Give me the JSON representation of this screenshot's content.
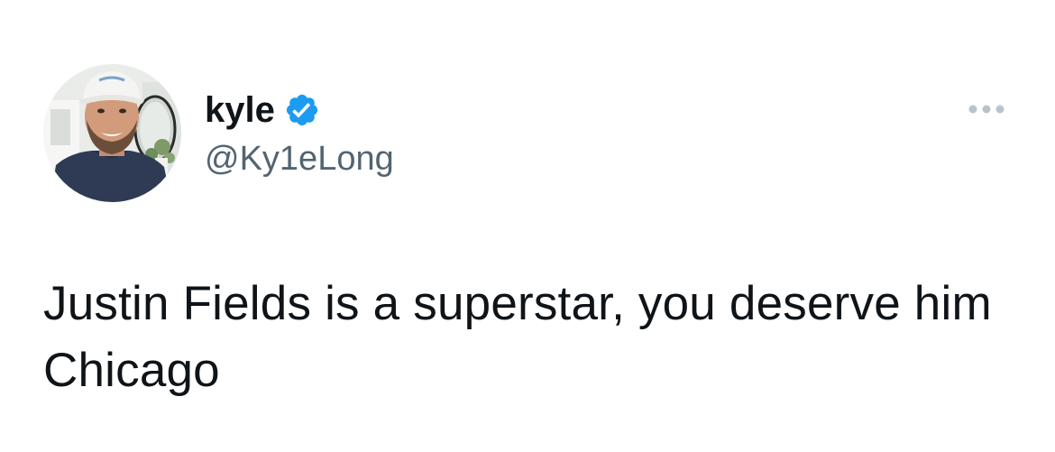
{
  "author": {
    "display_name": "kyle",
    "handle": "@Ky1eLong",
    "verified": true,
    "verified_icon": "verified-badge-icon",
    "avatar_icon": "profile-photo"
  },
  "tweet": {
    "text": "Justin Fields is a superstar, you deserve him Chicago"
  },
  "actions": {
    "more_icon": "more-horizontal-icon"
  },
  "colors": {
    "text_primary": "#0f1419",
    "text_secondary": "#536471",
    "verified_blue": "#1d9bf0",
    "more_dots": "#b9c3cb",
    "background": "#ffffff"
  }
}
